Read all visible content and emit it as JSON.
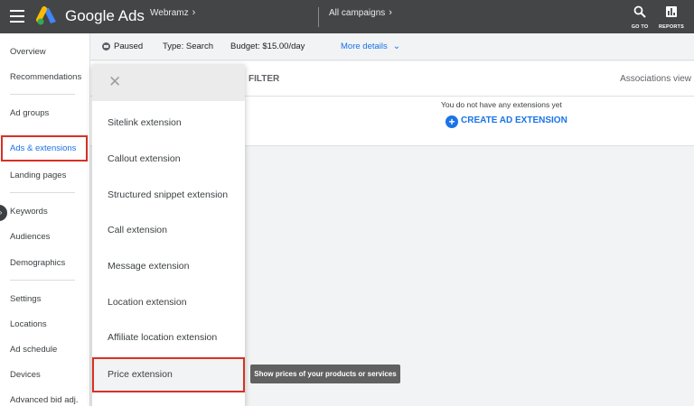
{
  "topbar": {
    "brand": "Google Ads",
    "account": "Webramz",
    "campaign_crumb": "All campaigns",
    "goto_label": "GO TO",
    "reports_label": "REPORTS"
  },
  "leftnav": {
    "items": [
      {
        "label": "Overview"
      },
      {
        "label": "Recommendations"
      },
      {
        "label": "Ad groups"
      },
      {
        "label": "Ads & extensions"
      },
      {
        "label": "Landing pages"
      },
      {
        "label": "Keywords"
      },
      {
        "label": "Audiences"
      },
      {
        "label": "Demographics"
      },
      {
        "label": "Settings"
      },
      {
        "label": "Locations"
      },
      {
        "label": "Ad schedule"
      },
      {
        "label": "Devices"
      },
      {
        "label": "Advanced bid adj."
      }
    ]
  },
  "statusbar": {
    "status": "Paused",
    "type": "Type: Search",
    "budget": "Budget: $15.00/day",
    "more_details": "More details"
  },
  "main": {
    "filter_label": "FILTER",
    "associations_view": "Associations view",
    "empty_message": "You do not have any extensions yet",
    "create_button": "CREATE AD EXTENSION"
  },
  "dropdown": {
    "items": [
      {
        "label": "Sitelink extension"
      },
      {
        "label": "Callout extension"
      },
      {
        "label": "Structured snippet extension"
      },
      {
        "label": "Call extension"
      },
      {
        "label": "Message extension"
      },
      {
        "label": "Location extension"
      },
      {
        "label": "Affiliate location extension"
      },
      {
        "label": "Price extension"
      }
    ]
  },
  "tooltip": {
    "text": "Show prices of your products or services"
  },
  "colors": {
    "topbar": "#444547",
    "accent": "#1a73e8",
    "highlight_border": "#d93025"
  },
  "icons": [
    "menu-icon",
    "google-ads-logo",
    "search-icon",
    "reports-icon",
    "close-icon",
    "add-circle-icon",
    "chevron-down-icon",
    "chevron-right-icon"
  ]
}
